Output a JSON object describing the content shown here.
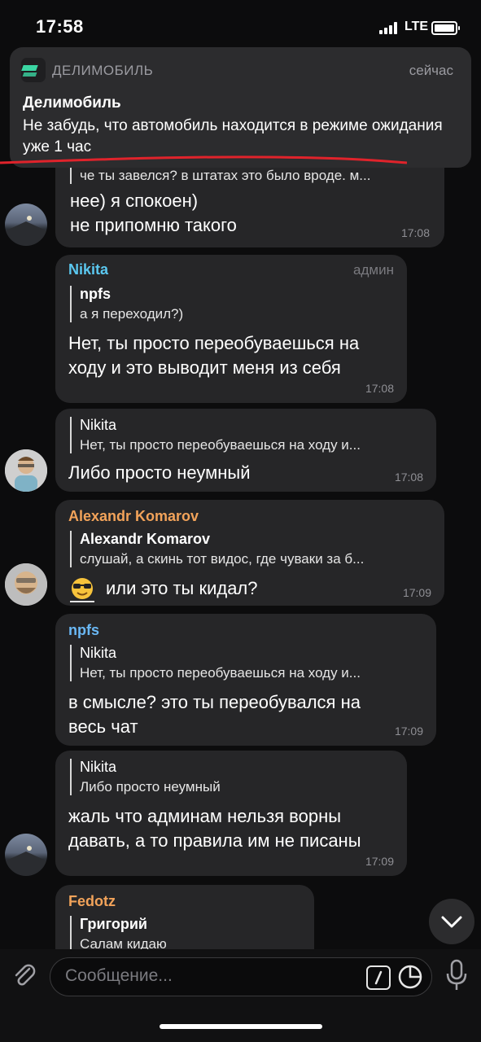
{
  "status_bar": {
    "time": "17:58",
    "network": "LTE"
  },
  "notification": {
    "app_name": "ДЕЛИМОБИЛЬ",
    "when": "сейчас",
    "title": "Делимобиль",
    "body": "Не забудь, что автомобиль находится в режиме ожидания уже 1 час"
  },
  "messages": [
    {
      "quote_text": "че ты завелся? в штатах это было вроде. м...",
      "text_lines": [
        "нее) я спокоен)",
        "не припомню такого"
      ],
      "time": "17:08"
    },
    {
      "sender": "Nikita",
      "sender_color": "#5bc8f0",
      "role": "админ",
      "quote_name": "npfs",
      "quote_text": "а я переходил?)",
      "text_lines": [
        "Нет, ты просто переобуваешься на",
        "ходу и это выводит меня из себя"
      ],
      "time": "17:08"
    },
    {
      "quote_name": "Nikita",
      "quote_text": "Нет, ты просто переобуваешься на ходу и...",
      "text_lines": [
        "Либо просто неумный"
      ],
      "time": "17:08"
    },
    {
      "sender": "Alexandr Komarov",
      "sender_color": "#f2a35a",
      "quote_name": "Alexandr Komarov",
      "quote_text": "слушай, а скинь тот видос, где чуваки за б...",
      "text_lines": [
        "или это ты кидал?"
      ],
      "time": "17:09"
    },
    {
      "sender": "npfs",
      "sender_color": "#6ab8f5",
      "quote_name": "Nikita",
      "quote_text": "Нет, ты просто переобуваешься на ходу и...",
      "text_lines": [
        "в смысле? это ты переобувался на",
        "весь чат"
      ],
      "time": "17:09"
    },
    {
      "quote_name": "Nikita",
      "quote_text": "Либо просто неумный",
      "text_lines": [
        "жаль что админам нельзя ворны",
        "давать, а то правила им не писаны"
      ],
      "time": "17:09"
    },
    {
      "sender": "Fedotz",
      "sender_color": "#f2a35a",
      "quote_name": "Григорий",
      "quote_text": "Салам кидаю"
    }
  ],
  "input": {
    "placeholder": "Сообщение..."
  },
  "icons": {
    "attach": "paperclip-icon",
    "commands": "slash-command-icon",
    "sticker": "sticker-icon",
    "mic": "microphone-icon",
    "scroll": "chevron-down-icon"
  }
}
